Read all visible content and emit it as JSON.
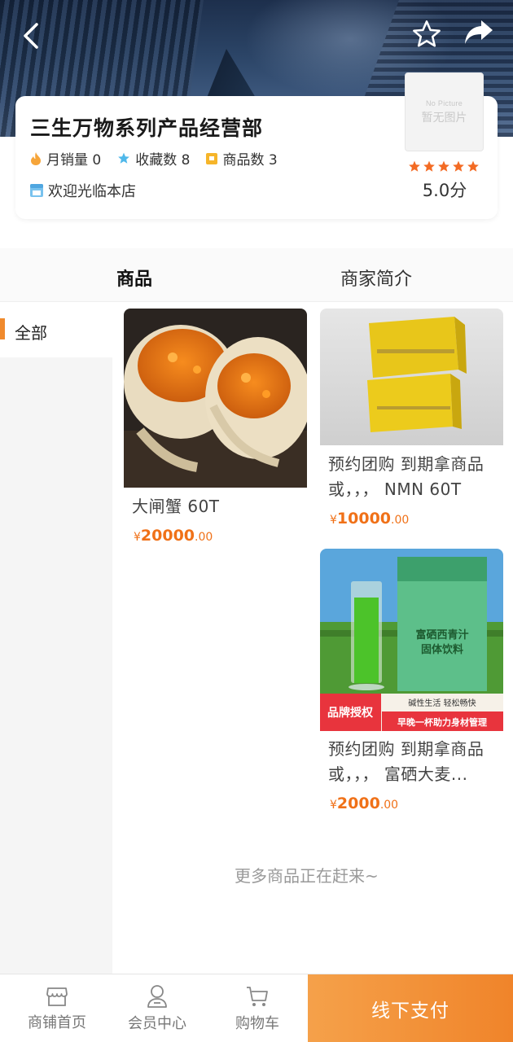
{
  "shop": {
    "name": "三生万物系列产品经营部",
    "monthly_sales_label": "月销量 0",
    "favorites_label": "收藏数 8",
    "products_label": "商品数 3",
    "welcome": "欢迎光临本店",
    "logo_placeholder_en": "No Picture",
    "logo_placeholder_cn": "暂无图片",
    "rating": "5.0分",
    "stars": 5
  },
  "tabs": [
    "商品",
    "商家简介"
  ],
  "sidebar": {
    "active_category": "全部"
  },
  "products": [
    {
      "name": "大闸蟹 60T",
      "price_symbol": "¥",
      "price_int": "20000",
      "price_dec": ".00"
    },
    {
      "name_line1": "预约团购 到期拿商品",
      "name_line2": "或，，， NMN 60T",
      "price_symbol": "¥",
      "price_int": "10000",
      "price_dec": ".00"
    },
    {
      "name_line1": "预约团购 到期拿商品",
      "name_line2": "或，，， 富硒大麦...",
      "price_symbol": "¥",
      "price_int": "2000",
      "price_dec": ".00",
      "image_text": {
        "title1": "富硒西青汁",
        "title2": "固体饮料",
        "tag": "碱性生活 轻松畅快",
        "badge": "品牌授权",
        "slogan": "早晚一杯助力身材管理"
      }
    }
  ],
  "more_text": "更多商品正在赶来~",
  "bottom_nav": {
    "home": "商铺首页",
    "member": "会员中心",
    "cart": "购物车",
    "pay": "线下支付"
  },
  "colors": {
    "accent": "#f0842a",
    "price": "#f07118",
    "star": "#f36b24"
  }
}
